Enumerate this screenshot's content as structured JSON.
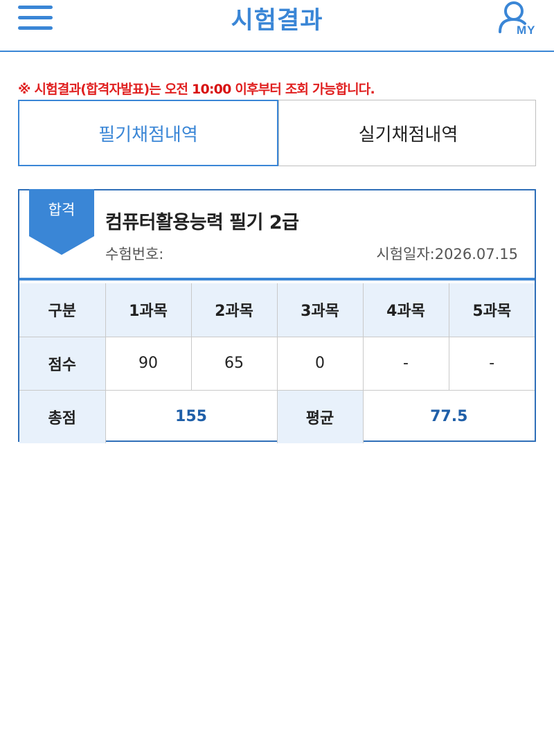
{
  "header": {
    "title": "시험결과",
    "my_label": "MY",
    "menu_icon": "hamburger-menu-icon",
    "user_icon": "user-icon",
    "accent_color": "#3a86d6"
  },
  "notice": {
    "prefix": "※ 시험결과(합격자발표)는 오전 ",
    "time": "10:00",
    "suffix": " 이후부터 조회 가능합니다."
  },
  "tabs": [
    {
      "label": "필기채점내역",
      "active": true
    },
    {
      "label": "실기채점내역",
      "active": false
    }
  ],
  "result": {
    "status": "합격",
    "exam_name": "컴퓨터활용능력 필기 2급",
    "exam_number_label": "수험번호:",
    "exam_date": "시험일자:2026.07.15",
    "table": {
      "header_row": [
        "구분",
        "1과목",
        "2과목",
        "3과목",
        "4과목",
        "5과목"
      ],
      "score_label": "점수",
      "scores": [
        "90",
        "65",
        "0",
        "-",
        "-"
      ],
      "total_label": "총점",
      "total": "155",
      "average_label": "평균",
      "average": "77.5"
    }
  }
}
